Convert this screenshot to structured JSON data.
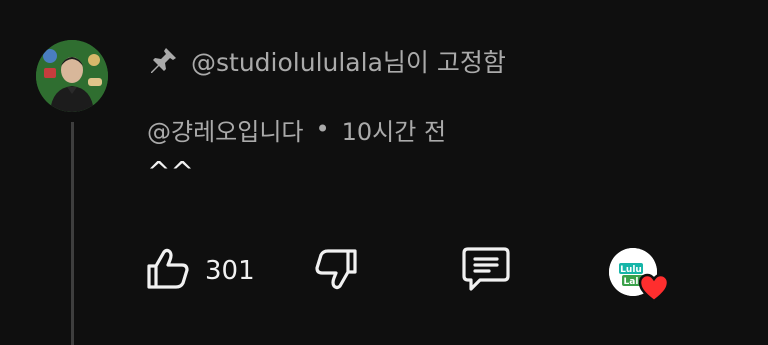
{
  "comment": {
    "pinned_by": "@studiolululala님이 고정함",
    "author": "@걍레오입니다",
    "separator": "•",
    "time": "10시간 전",
    "text": "^^"
  },
  "actions": {
    "like_count": "301"
  },
  "creator_avatar": {
    "line1": "Lulu",
    "line2": "Lala"
  },
  "icons": {
    "pin": "pin-icon",
    "like": "thumbs-up-icon",
    "dislike": "thumbs-down-icon",
    "reply": "comment-icon",
    "heart": "heart-icon"
  },
  "colors": {
    "background": "#0f0f0f",
    "primary_text": "#f1f1f1",
    "secondary_text": "#aaaaaa",
    "heart": "#ff2e2e",
    "lulu_teal": "#16b5a8",
    "lala_green": "#3aa14a"
  }
}
